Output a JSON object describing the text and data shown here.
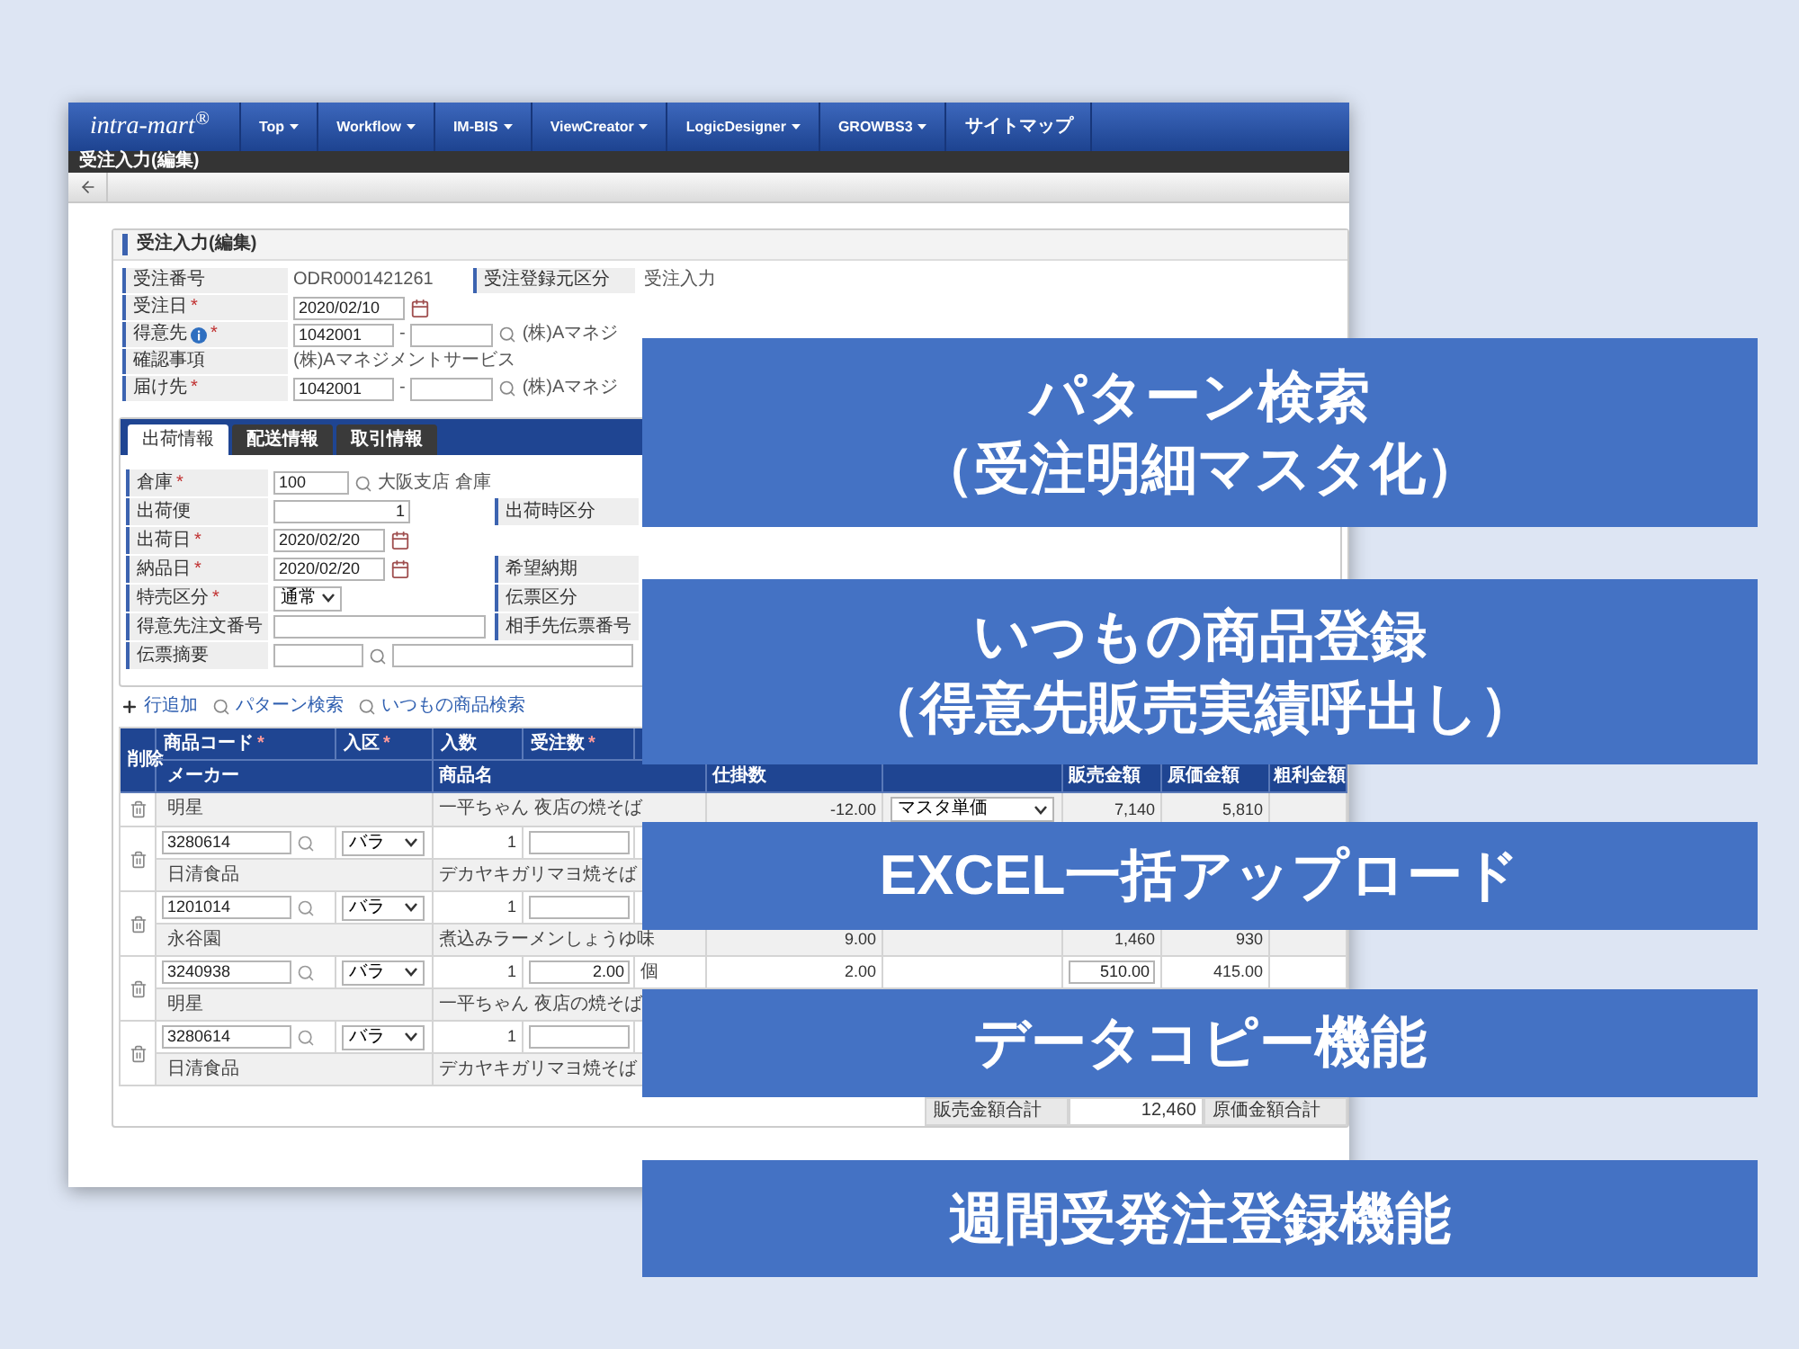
{
  "nav": {
    "logo": "intra-mart$^{®}$",
    "menu": [
      {
        "label": "Top",
        "dropdown": true
      },
      {
        "label": "Workflow",
        "dropdown": true
      },
      {
        "label": "IM-BIS",
        "dropdown": true
      },
      {
        "label": "ViewCreator",
        "dropdown": true
      },
      {
        "label": "LogicDesigner",
        "dropdown": true
      },
      {
        "label": "GROWBS3",
        "dropdown": true
      },
      {
        "label": "サイトマップ",
        "dropdown": false
      }
    ]
  },
  "page_title": "受注入力(編集)",
  "card_title": "受注入力(編集)",
  "header_form": [
    {
      "label": "受注番号",
      "cells": [
        {
          "kind": "text",
          "value": "ODR0001421261"
        }
      ],
      "right": {
        "label": "受注登録元区分",
        "cells": [
          {
            "kind": "text",
            "value": "受注入力"
          }
        ]
      }
    },
    {
      "label": "受注日",
      "mark": "*",
      "cells": [
        {
          "kind": "date",
          "value": "2020/02/10"
        },
        {
          "kind": "calendar"
        }
      ]
    },
    {
      "label": "得意先",
      "info": true,
      "mark": "*",
      "cells": [
        {
          "kind": "code",
          "value": "1042001"
        },
        {
          "kind": "text",
          "value": "-"
        },
        {
          "kind": "sub"
        },
        {
          "kind": "search"
        },
        {
          "kind": "text",
          "value": "(株)Aマネジ"
        }
      ]
    },
    {
      "label": "確認事項",
      "cells": [
        {
          "kind": "text",
          "value": "(株)Aマネジメントサービス"
        }
      ]
    },
    {
      "label": "届け先",
      "mark": "*",
      "cells": [
        {
          "kind": "code",
          "value": "1042001"
        },
        {
          "kind": "text",
          "value": "-"
        },
        {
          "kind": "sub"
        },
        {
          "kind": "search"
        },
        {
          "kind": "text",
          "value": "(株)Aマネジ"
        }
      ]
    }
  ],
  "tabs": [
    {
      "label": "出荷情報",
      "selected": true
    },
    {
      "label": "配送情報",
      "selected": false
    },
    {
      "label": "取引情報",
      "selected": false
    }
  ],
  "tab_form": [
    {
      "label": "倉庫",
      "mark": "*",
      "cells": [
        {
          "kind": "short",
          "value": "100"
        },
        {
          "kind": "search"
        },
        {
          "kind": "text",
          "value": "大阪支店 倉庫"
        }
      ]
    },
    {
      "label": "出荷便",
      "cells": [
        {
          "kind": "qty",
          "value": "1"
        }
      ],
      "right": {
        "label": "出荷時区分"
      }
    },
    {
      "label": "出荷日",
      "mark": "*",
      "cells": [
        {
          "kind": "date",
          "value": "2020/02/20"
        },
        {
          "kind": "calendar"
        }
      ]
    },
    {
      "label": "納品日",
      "mark": "*",
      "cells": [
        {
          "kind": "date",
          "value": "2020/02/20"
        },
        {
          "kind": "calendar"
        }
      ],
      "right": {
        "label": "希望納期"
      }
    },
    {
      "label": "特売区分",
      "mark": "*",
      "cells": [
        {
          "kind": "select",
          "value": "通常"
        }
      ],
      "right": {
        "label": "伝票区分"
      }
    },
    {
      "label": "得意先注文番号",
      "cells": [
        {
          "kind": "wide"
        }
      ],
      "right": {
        "label": "相手先伝票番号"
      }
    },
    {
      "label": "伝票摘要",
      "cells": [
        {
          "kind": "blank"
        },
        {
          "kind": "search"
        },
        {
          "kind": "long"
        }
      ]
    }
  ],
  "actions": [
    {
      "kind": "add",
      "label": "行追加"
    },
    {
      "kind": "search",
      "label": "パターン検索"
    },
    {
      "kind": "search",
      "label": "いつもの商品検索"
    }
  ],
  "table": {
    "header_top": [
      {
        "label": "削除"
      },
      {
        "label": "商品コード",
        "mark": "*"
      },
      {
        "label": "入区",
        "mark": "*"
      },
      {
        "label": "入数"
      },
      {
        "label": "受注数",
        "mark": "*"
      }
    ],
    "header_bottom": {
      "maker": "メーカー",
      "product_name": "商品名",
      "column_7": "仕掛数",
      "sales_amount": "販売金額",
      "cost_amount": "原価金額",
      "profit_amount": "粗利金額"
    },
    "rows": [
      {
        "kind": "partial",
        "maker": "明星",
        "product_name": "一平ちゃん 夜店の焼そば",
        "column_7": "-12.00",
        "price_type": "マスタ単価",
        "sales_amount": "7,140",
        "cost_amount": "5,810"
      },
      {
        "kind": "full",
        "code": "3280614",
        "unit_type": "バラ",
        "per_case": "1",
        "maker": "日清食品",
        "product_name": "デカヤキガリマヨ焼そば"
      },
      {
        "kind": "full",
        "code": "1201014",
        "unit_type": "バラ",
        "per_case": "1",
        "maker": "永谷園",
        "product_name": "煮込みラーメンしょうゆ味",
        "column_7": "9.00",
        "sales_amount": "1,460",
        "cost_amount": "930"
      },
      {
        "kind": "full",
        "code": "3240938",
        "unit_type": "バラ",
        "per_case": "1",
        "order_qty": "2.00",
        "unit": "個",
        "column_7_upper": "2.00",
        "sales_input": "510.00",
        "cost_upper": "415.00",
        "maker": "明星",
        "product_name": "一平ちゃん 夜店の焼そば"
      },
      {
        "kind": "full",
        "code": "3280614",
        "unit_type": "バラ",
        "per_case": "1",
        "maker": "日清食品",
        "product_name": "デカヤキガリマヨ焼そば"
      }
    ]
  },
  "totals": [
    {
      "kind": "label",
      "text": "販売金額合計"
    },
    {
      "kind": "value",
      "text": "12,460"
    },
    {
      "kind": "label",
      "text": "原価金額合計"
    }
  ],
  "callouts": [
    {
      "lines": [
        "パターン検索",
        "（受注明細マスタ化）"
      ]
    },
    {
      "lines": [
        "いつもの商品登録",
        "（得意先販売実績呼出し）"
      ]
    },
    {
      "lines": [
        "EXCEL一括アップロード"
      ]
    },
    {
      "lines": [
        "データコピー機能"
      ]
    },
    {
      "lines": [
        "週間受発注登録機能"
      ]
    }
  ]
}
